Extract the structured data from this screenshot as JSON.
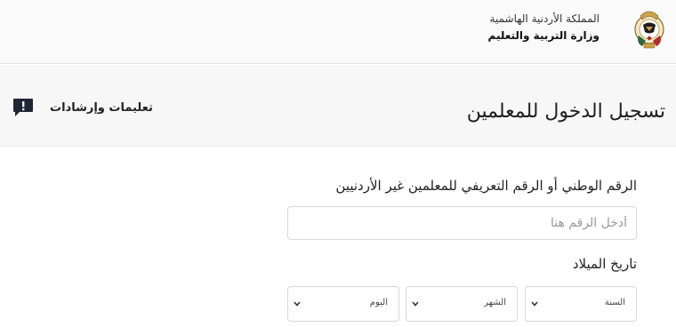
{
  "header": {
    "kingdom_name": "المملكة الأردنية الهاشمية",
    "ministry_name": "وزارة التربية والتعليم"
  },
  "titlebar": {
    "title": "تسجيل الدخول للمعلمين",
    "help_label": "تعليمات وإرشادات",
    "help_icon": "message-alert-icon"
  },
  "form": {
    "id_label": "الرقم الوطني أو الرقم التعريفي للمعلمين غير الأردنيين",
    "id_placeholder": "أدخل الرقم هنا",
    "dob_label": "تاريخ الميلاد",
    "year_select": "السنة",
    "month_select": "الشهر",
    "day_select": "اليوم"
  },
  "colors": {
    "header_bg": "#fafafa",
    "titlebar_bg": "#f7f7f7",
    "icon_dark": "#1f2533",
    "border": "#d8d8d8"
  }
}
